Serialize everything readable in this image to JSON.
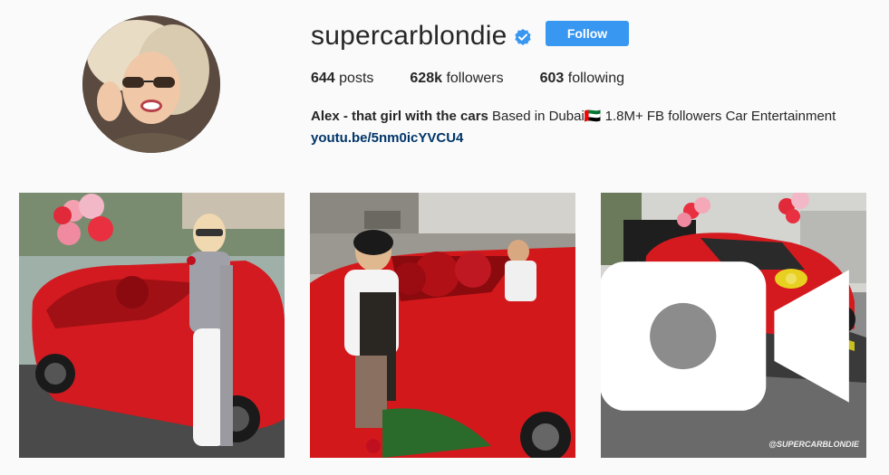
{
  "profile": {
    "username": "supercarblondie",
    "follow_label": "Follow",
    "verified": true
  },
  "stats": {
    "posts_count": "644",
    "posts_label": "posts",
    "followers_count": "628k",
    "followers_label": "followers",
    "following_count": "603",
    "following_label": "following"
  },
  "bio": {
    "name": "Alex - that girl with the cars",
    "text": "Based in Dubai🇦🇪 1.8M+ FB followers Car Entertainment",
    "link": "youtu.be/5nm0icYVCU4"
  },
  "posts": [
    {
      "type": "image"
    },
    {
      "type": "image"
    },
    {
      "type": "video",
      "watermark": "@SUPERCARBLONDIE"
    }
  ],
  "colors": {
    "follow_button": "#3897f0",
    "link": "#003569",
    "verified_badge": "#3897f0",
    "background": "#fafafa"
  }
}
